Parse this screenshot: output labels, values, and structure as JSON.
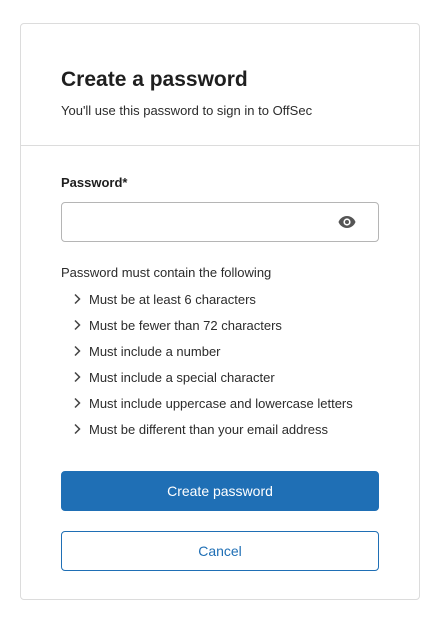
{
  "header": {
    "title": "Create a password",
    "subtitle": "You'll use this password to sign in to OffSec"
  },
  "form": {
    "password_label": "Password*",
    "password_value": "",
    "password_placeholder": "",
    "show_password_icon": "eye-icon",
    "requirements_intro": "Password must contain the following",
    "requirements": [
      "Must be at least 6 characters",
      "Must be fewer than 72 characters",
      "Must include a number",
      "Must include a special character",
      "Must include uppercase and lowercase letters",
      "Must be different than your email address"
    ]
  },
  "actions": {
    "create_label": "Create password",
    "cancel_label": "Cancel"
  },
  "colors": {
    "primary": "#1f6fb5",
    "border": "#dcdcdc",
    "text": "#1f1f1f"
  }
}
